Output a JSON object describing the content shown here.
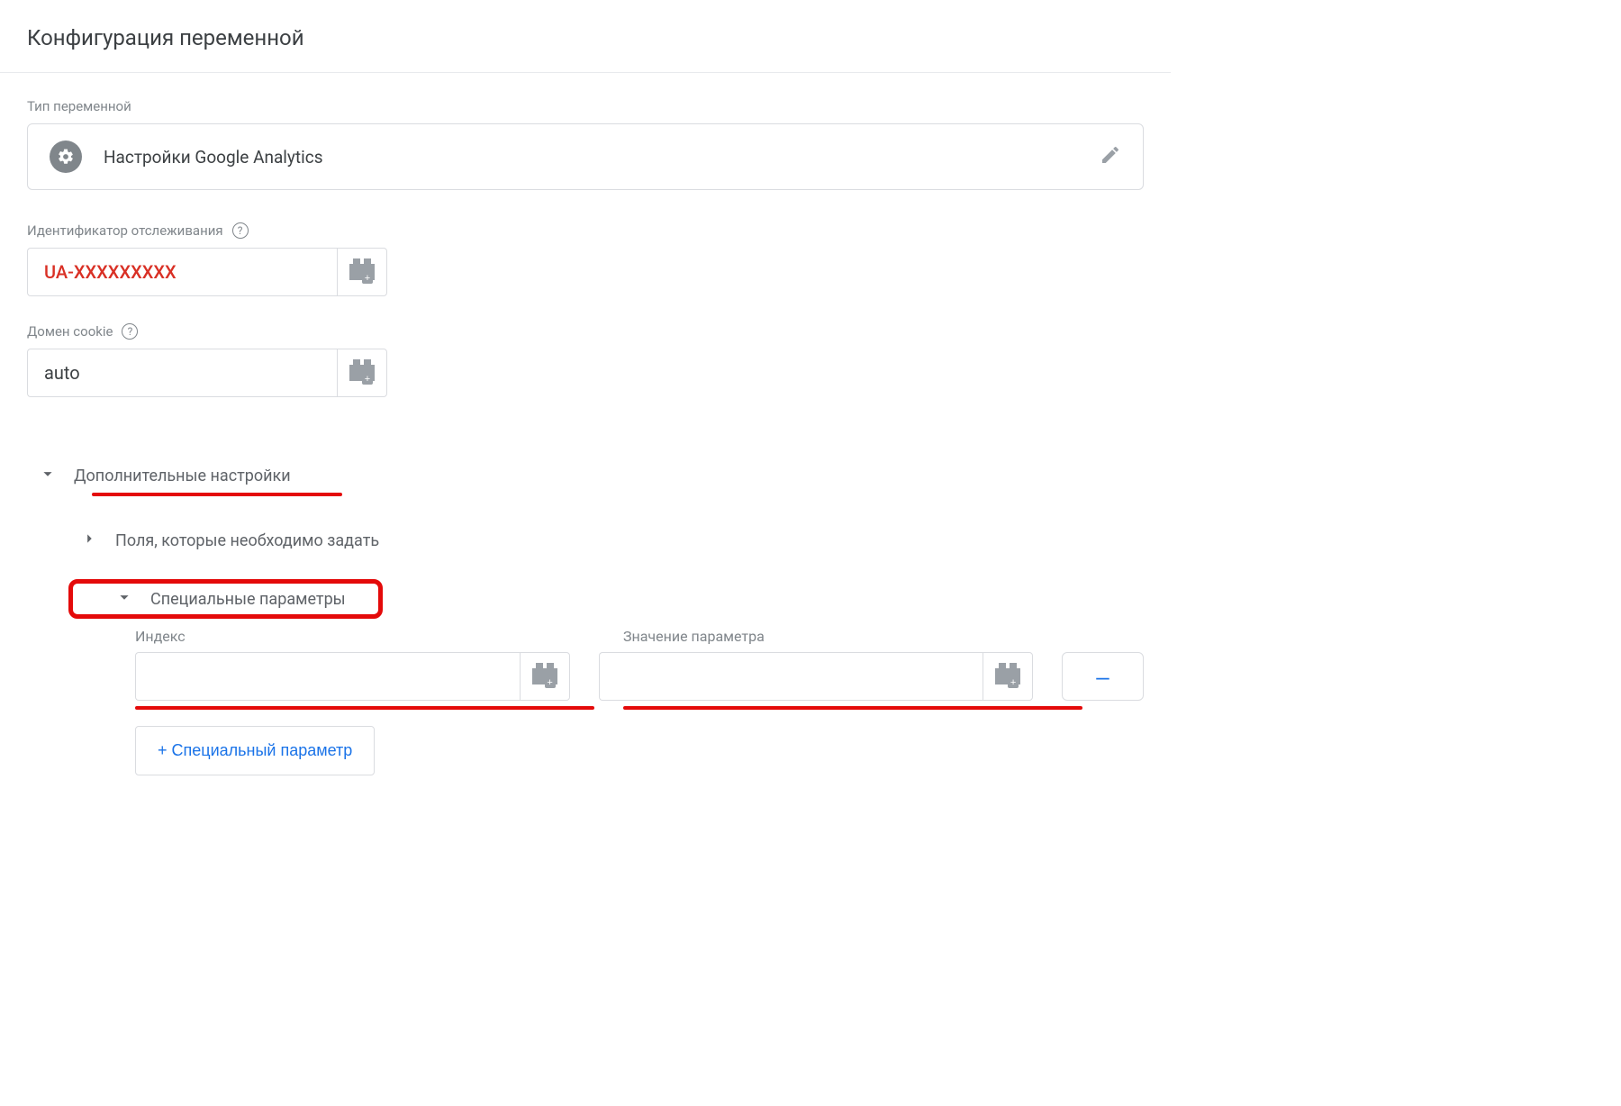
{
  "title": "Конфигурация переменной",
  "variable_type": {
    "label": "Тип переменной",
    "name": "Настройки Google Analytics"
  },
  "tracking_id": {
    "label": "Идентификатор отслеживания",
    "value": "UA-XXXXXXXXX"
  },
  "cookie_domain": {
    "label": "Домен cookie",
    "value": "auto"
  },
  "sections": {
    "more_settings": "Дополнительные настройки",
    "fields_to_set": "Поля, которые необходимо задать",
    "custom_dimensions": "Специальные параметры"
  },
  "custom_dimensions": {
    "index_label": "Индекс",
    "value_label": "Значение параметра",
    "rows": [
      {
        "index": "",
        "value": ""
      }
    ],
    "remove_label": "–",
    "add_button": "+ Специальный параметр"
  }
}
